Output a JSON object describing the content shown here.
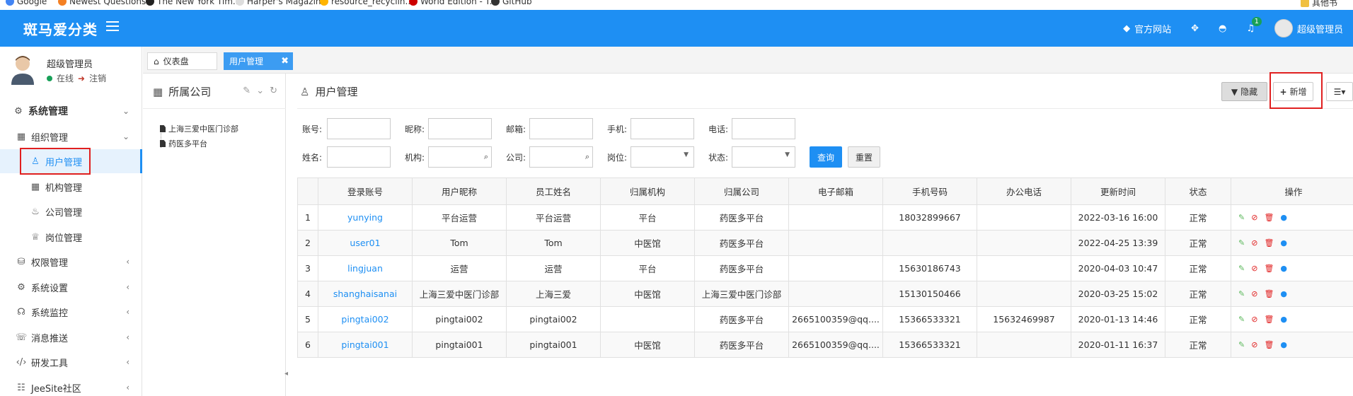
{
  "bookmarks": [
    "Google",
    "Newest Questions...",
    "The New York Tim...",
    "Harper's Magazine",
    "resource_recyclin...",
    "World Edition - T...",
    "GitHub",
    "其他书"
  ],
  "header": {
    "brand": "斑马爱分类",
    "official_site": "官方网站",
    "notification_count": "1",
    "user": "超级管理员"
  },
  "sidebar": {
    "user_name": "超级管理员",
    "status_online": "在线",
    "logout": "注销",
    "menu": {
      "system": "系统管理",
      "org": "组织管理",
      "user_mgmt": "用户管理",
      "office_mgmt": "机构管理",
      "company_mgmt": "公司管理",
      "post_mgmt": "岗位管理",
      "perm": "权限管理",
      "settings": "系统设置",
      "monitor": "系统监控",
      "push": "消息推送",
      "devtools": "研发工具",
      "community": "JeeSite社区"
    }
  },
  "tabs": {
    "dashboard": "仪表盘",
    "current": "用户管理",
    "close": "✖"
  },
  "tree": {
    "title": "所属公司",
    "nodes": [
      "上海三爱中医门诊部",
      "药医多平台"
    ]
  },
  "main": {
    "title": "用户管理",
    "hide_btn": "隐藏",
    "add_btn": "新增",
    "search": {
      "account": "账号:",
      "nickname": "昵称:",
      "email": "邮箱:",
      "mobile": "手机:",
      "phone": "电话:",
      "name": "姓名:",
      "office": "机构:",
      "company": "公司:",
      "post": "岗位:",
      "status": "状态:",
      "query": "查询",
      "reset": "重置"
    },
    "columns": [
      "登录账号",
      "用户昵称",
      "员工姓名",
      "归属机构",
      "归属公司",
      "电子邮箱",
      "手机号码",
      "办公电话",
      "更新时间",
      "状态",
      "操作"
    ],
    "rows": [
      {
        "no": "1",
        "account": "yunying",
        "nickname": "平台运营",
        "name": "平台运营",
        "office": "平台",
        "company": "药医多平台",
        "email": "",
        "mobile": "18032899667",
        "phone": "",
        "updated": "2022-03-16 16:00",
        "status": "正常"
      },
      {
        "no": "2",
        "account": "user01",
        "nickname": "Tom",
        "name": "Tom",
        "office": "中医馆",
        "company": "药医多平台",
        "email": "",
        "mobile": "",
        "phone": "",
        "updated": "2022-04-25 13:39",
        "status": "正常"
      },
      {
        "no": "3",
        "account": "lingjuan",
        "nickname": "运营",
        "name": "运营",
        "office": "平台",
        "company": "药医多平台",
        "email": "",
        "mobile": "15630186743",
        "phone": "",
        "updated": "2020-04-03 10:47",
        "status": "正常"
      },
      {
        "no": "4",
        "account": "shanghaisanai",
        "nickname": "上海三爱中医门诊部",
        "name": "上海三爱",
        "office": "中医馆",
        "company": "上海三爱中医门诊部",
        "email": "",
        "mobile": "15130150466",
        "phone": "",
        "updated": "2020-03-25 15:02",
        "status": "正常"
      },
      {
        "no": "5",
        "account": "pingtai002",
        "nickname": "pingtai002",
        "name": "pingtai002",
        "office": "",
        "company": "药医多平台",
        "email": "2665100359@qq....",
        "mobile": "15366533321",
        "phone": "15632469987",
        "updated": "2020-01-13 14:46",
        "status": "正常"
      },
      {
        "no": "6",
        "account": "pingtai001",
        "nickname": "pingtai001",
        "name": "pingtai001",
        "office": "中医馆",
        "company": "药医多平台",
        "email": "2665100359@qq....",
        "mobile": "15366533321",
        "phone": "",
        "updated": "2020-01-11 16:37",
        "status": "正常"
      }
    ]
  },
  "colors": {
    "primary": "#1e8ff3",
    "header_bg": "#1e8ff3",
    "online": "#18a058",
    "highlight_box": "#e02020",
    "op_edit": "#5cb85c",
    "op_disable": "#e02020",
    "op_delete": "#e02020",
    "op_more": "#1e8ff3"
  }
}
